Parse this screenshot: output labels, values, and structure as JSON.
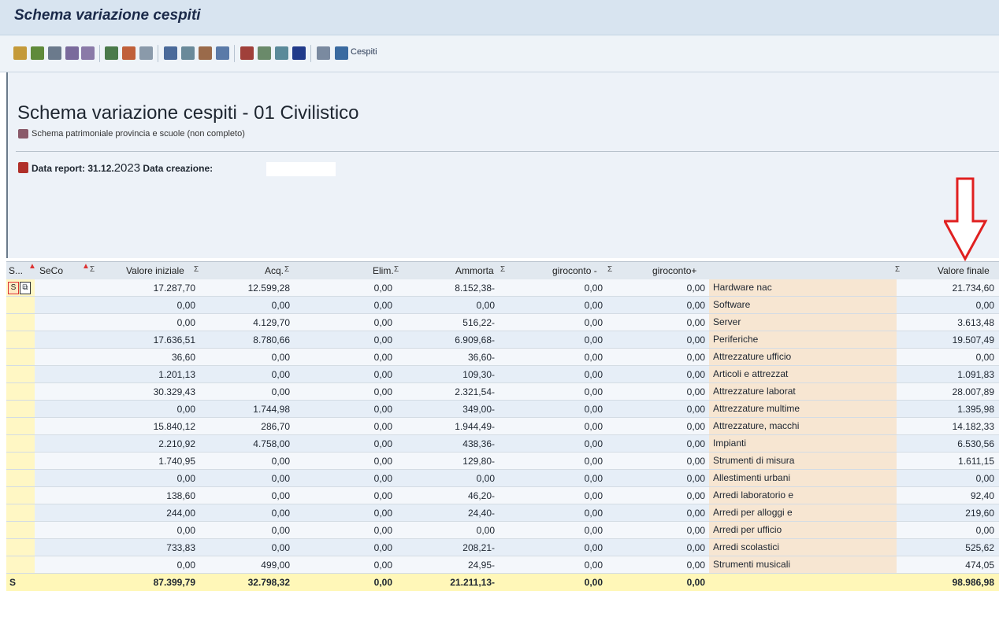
{
  "window": {
    "title": "Schema variazione cespiti"
  },
  "toolbar": {
    "icons": [
      "details-icon",
      "select-icon",
      "print-icon",
      "filter-icon",
      "delete-filter-icon",
      "sum-icon",
      "subtotal-icon",
      "graphic-icon",
      "export-icon",
      "abc-icon",
      "mail-icon",
      "layout-icon",
      "grid-icon",
      "choose-layout-icon",
      "save-layout-icon",
      "info-icon",
      "list-icon",
      "assets-icon"
    ],
    "cespiti_label": "Cespiti"
  },
  "header": {
    "title": "Schema variazione cespiti - 01 Civilistico",
    "subtitle": "Schema patrimoniale provincia e scuole (non completo)",
    "data_report_label": "Data report: 31.12.",
    "data_report_year": "2023",
    "data_creazione_label": " Data creazione:"
  },
  "table": {
    "columns": {
      "s": "S...",
      "seco": "SeCo",
      "valore_iniziale": "Valore iniziale",
      "acq": "Acq.",
      "elim": "Elim.",
      "ammorta": "Ammorta",
      "giroconto_minus": "giroconto -",
      "giroconto_plus": "giroconto+",
      "desc": "",
      "valore_finale": "Valore finale"
    },
    "rows": [
      {
        "vi": "17.287,70",
        "acq": "12.599,28",
        "elim": "0,00",
        "amm": "8.152,38-",
        "gm": "0,00",
        "gp": "0,00",
        "desc": "Hardware nac",
        "vf": "21.734,60"
      },
      {
        "vi": "0,00",
        "acq": "0,00",
        "elim": "0,00",
        "amm": "0,00",
        "gm": "0,00",
        "gp": "0,00",
        "desc": "Software",
        "vf": "0,00"
      },
      {
        "vi": "0,00",
        "acq": "4.129,70",
        "elim": "0,00",
        "amm": "516,22-",
        "gm": "0,00",
        "gp": "0,00",
        "desc": "Server",
        "vf": "3.613,48"
      },
      {
        "vi": "17.636,51",
        "acq": "8.780,66",
        "elim": "0,00",
        "amm": "6.909,68-",
        "gm": "0,00",
        "gp": "0,00",
        "desc": "Periferiche",
        "vf": "19.507,49"
      },
      {
        "vi": "36,60",
        "acq": "0,00",
        "elim": "0,00",
        "amm": "36,60-",
        "gm": "0,00",
        "gp": "0,00",
        "desc": "Attrezzature ufficio",
        "vf": "0,00"
      },
      {
        "vi": "1.201,13",
        "acq": "0,00",
        "elim": "0,00",
        "amm": "109,30-",
        "gm": "0,00",
        "gp": "0,00",
        "desc": "Articoli e attrezzat",
        "vf": "1.091,83"
      },
      {
        "vi": "30.329,43",
        "acq": "0,00",
        "elim": "0,00",
        "amm": "2.321,54-",
        "gm": "0,00",
        "gp": "0,00",
        "desc": "Attrezzature laborat",
        "vf": "28.007,89"
      },
      {
        "vi": "0,00",
        "acq": "1.744,98",
        "elim": "0,00",
        "amm": "349,00-",
        "gm": "0,00",
        "gp": "0,00",
        "desc": "Attrezzature multime",
        "vf": "1.395,98"
      },
      {
        "vi": "15.840,12",
        "acq": "286,70",
        "elim": "0,00",
        "amm": "1.944,49-",
        "gm": "0,00",
        "gp": "0,00",
        "desc": "Attrezzature, macchi",
        "vf": "14.182,33"
      },
      {
        "vi": "2.210,92",
        "acq": "4.758,00",
        "elim": "0,00",
        "amm": "438,36-",
        "gm": "0,00",
        "gp": "0,00",
        "desc": "Impianti",
        "vf": "6.530,56"
      },
      {
        "vi": "1.740,95",
        "acq": "0,00",
        "elim": "0,00",
        "amm": "129,80-",
        "gm": "0,00",
        "gp": "0,00",
        "desc": "Strumenti di misura",
        "vf": "1.611,15"
      },
      {
        "vi": "0,00",
        "acq": "0,00",
        "elim": "0,00",
        "amm": "0,00",
        "gm": "0,00",
        "gp": "0,00",
        "desc": "Allestimenti urbani",
        "vf": "0,00"
      },
      {
        "vi": "138,60",
        "acq": "0,00",
        "elim": "0,00",
        "amm": "46,20-",
        "gm": "0,00",
        "gp": "0,00",
        "desc": "Arredi laboratorio e",
        "vf": "92,40"
      },
      {
        "vi": "244,00",
        "acq": "0,00",
        "elim": "0,00",
        "amm": "24,40-",
        "gm": "0,00",
        "gp": "0,00",
        "desc": "Arredi per alloggi e",
        "vf": "219,60"
      },
      {
        "vi": "0,00",
        "acq": "0,00",
        "elim": "0,00",
        "amm": "0,00",
        "gm": "0,00",
        "gp": "0,00",
        "desc": "Arredi per ufficio",
        "vf": "0,00"
      },
      {
        "vi": "733,83",
        "acq": "0,00",
        "elim": "0,00",
        "amm": "208,21-",
        "gm": "0,00",
        "gp": "0,00",
        "desc": "Arredi scolastici",
        "vf": "525,62"
      },
      {
        "vi": "0,00",
        "acq": "499,00",
        "elim": "0,00",
        "amm": "24,95-",
        "gm": "0,00",
        "gp": "0,00",
        "desc": "Strumenti musicali",
        "vf": "474,05"
      }
    ],
    "totals": {
      "s": "S",
      "vi": "87.399,79",
      "acq": "32.798,32",
      "elim": "0,00",
      "amm": "21.211,13-",
      "gm": "0,00",
      "gp": "0,00",
      "vf": "98.986,98"
    },
    "first_row_s": "S"
  },
  "colors": {
    "arrow": "#e02020",
    "desc_bg": "#f7e6d2",
    "total_bg": "#fff7b8"
  }
}
